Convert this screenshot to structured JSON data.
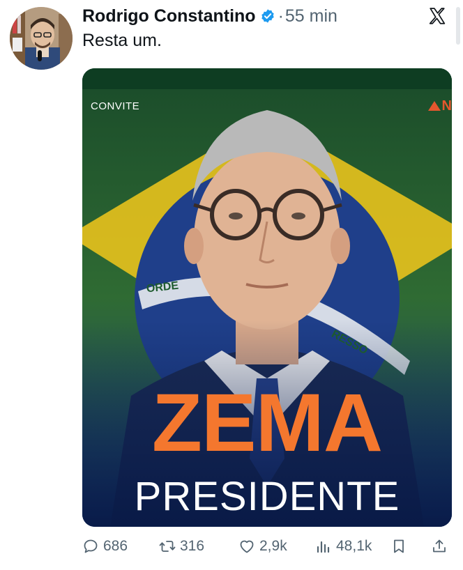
{
  "author": {
    "name": "Rodrigo Constantino",
    "separator": "·",
    "time": "55 min"
  },
  "tweet": {
    "text": "Resta um."
  },
  "media": {
    "label_top": "CONVITE",
    "brand_letter": "N",
    "headline": "ZEMA",
    "subheadline": "PRESIDENTE",
    "flag_band_left": "ORDE",
    "flag_band_right": "RESSO"
  },
  "actions": {
    "replies": "686",
    "retweets": "316",
    "likes": "2,9k",
    "views": "48,1k"
  },
  "icons": [
    "verified-badge-icon",
    "x-logo-icon",
    "reply-icon",
    "retweet-icon",
    "like-icon",
    "views-icon",
    "bookmark-icon",
    "share-icon"
  ],
  "colors": {
    "accent_orange": "#f4772e",
    "verified_blue": "#1d9bf0",
    "muted_text": "#536471"
  }
}
